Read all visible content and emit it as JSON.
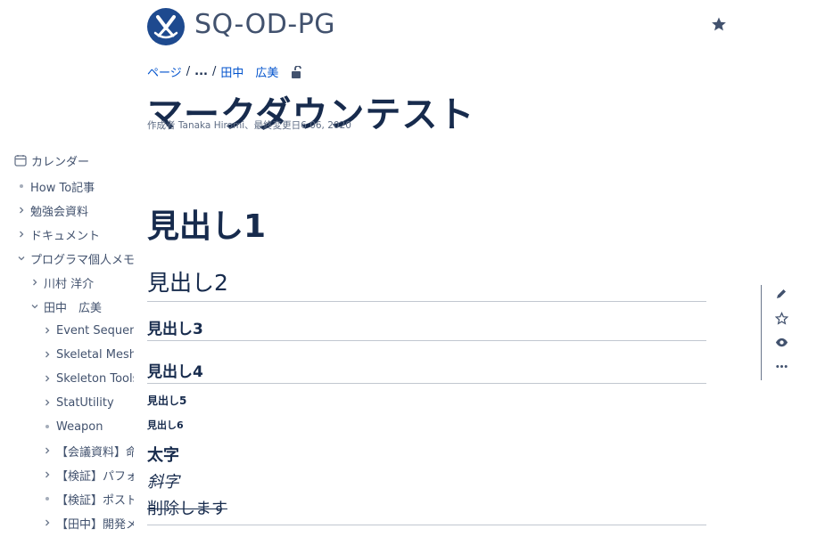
{
  "space": {
    "name": "SQ-OD-PG",
    "logo": "space-logo-icon",
    "brand_color": "#1e4a8f"
  },
  "breadcrumb": {
    "pages": "ページ",
    "ellipsis": "...",
    "parent": "田中　広美"
  },
  "page": {
    "title": "マークダウンテスト",
    "byline": "作成者 Tanaka Hiromi、最終変更日6 06, 2020"
  },
  "sidebar": {
    "calendar": "カレンダー",
    "items": [
      {
        "label": "How To記事",
        "type": "bullet"
      },
      {
        "label": "勉強会資料",
        "type": "collapsed"
      },
      {
        "label": "ドキュメント",
        "type": "collapsed"
      },
      {
        "label": "プログラマ個人メモ",
        "type": "expanded"
      },
      {
        "label": "川村 洋介",
        "type": "collapsed"
      },
      {
        "label": "田中　広美",
        "type": "expanded"
      },
      {
        "label": "Event Sequencer",
        "type": "collapsed"
      },
      {
        "label": "Skeletal Mesh Viewer",
        "type": "collapsed"
      },
      {
        "label": "Skeleton Tools",
        "type": "collapsed"
      },
      {
        "label": "StatUtility",
        "type": "collapsed"
      },
      {
        "label": "Weapon",
        "type": "bullet"
      },
      {
        "label": "【会議資料】命名規則",
        "type": "collapsed"
      },
      {
        "label": "【検証】パフォーマンス",
        "type": "collapsed"
      },
      {
        "label": "【検証】ポストプロセス",
        "type": "bullet"
      },
      {
        "label": "【田中】開発メモ",
        "type": "collapsed"
      }
    ]
  },
  "content": {
    "h1": "見出し1",
    "h2": "見出し2",
    "h3": "見出し3",
    "h4": "見出し4",
    "h5": "見出し5",
    "h6": "見出し6",
    "bold": "太字",
    "italic": "斜字",
    "strike": "削除します"
  },
  "actions": [
    "edit-icon",
    "star-icon",
    "watch-icon",
    "more-icon"
  ],
  "colors": {
    "link": "#0052cc",
    "text": "#172b4d",
    "muted": "#42526e"
  }
}
